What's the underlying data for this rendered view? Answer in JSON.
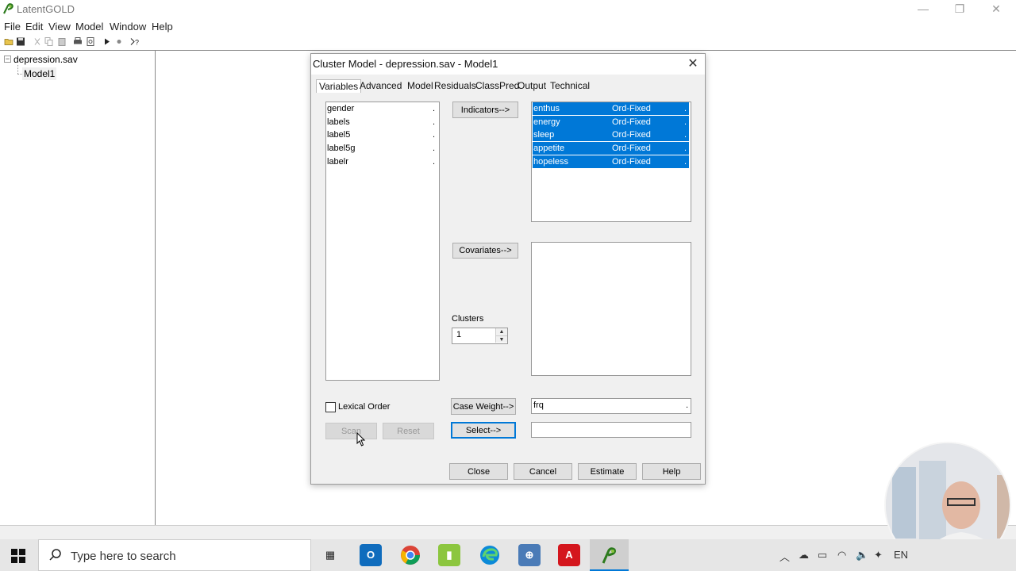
{
  "app": {
    "title": "LatentGOLD",
    "window_controls": {
      "minimize": "—",
      "maximize": "❐",
      "close": "✕"
    }
  },
  "menu": [
    "File",
    "Edit",
    "View",
    "Model",
    "Window",
    "Help"
  ],
  "toolbar_icons": [
    "open-icon",
    "save-icon",
    "cut-icon",
    "copy-icon",
    "paste-icon",
    "print-icon",
    "print-preview-icon",
    "run-icon",
    "stop-icon",
    "help-context-icon"
  ],
  "tree": {
    "root": "depression.sav",
    "child": "Model1"
  },
  "dialog": {
    "title": "Cluster Model - depression.sav - Model1",
    "tabs": [
      "Variables",
      "Advanced",
      "Model",
      "Residuals",
      "ClassPred",
      "Output",
      "Technical"
    ],
    "active_tab": "Variables",
    "available_variables": [
      "gender",
      "labels",
      "label5",
      "label5g",
      "labelr"
    ],
    "indicators_button": "Indicators-->",
    "indicators": [
      {
        "name": "enthus",
        "type": "Ord-Fixed"
      },
      {
        "name": "energy",
        "type": "Ord-Fixed"
      },
      {
        "name": "sleep",
        "type": "Ord-Fixed"
      },
      {
        "name": "appetite",
        "type": "Ord-Fixed"
      },
      {
        "name": "hopeless",
        "type": "Ord-Fixed"
      }
    ],
    "covariates_button": "Covariates-->",
    "clusters_label": "Clusters",
    "clusters_value": "1",
    "lexical_order_label": "Lexical Order",
    "scan_button": "Scan",
    "reset_button": "Reset",
    "case_weight_button": "Case Weight-->",
    "case_weight_value": "frq",
    "select_button": "Select-->",
    "select_value": "",
    "footer_buttons": {
      "close": "Close",
      "cancel": "Cancel",
      "estimate": "Estimate",
      "help": "Help"
    }
  },
  "taskbar": {
    "search_placeholder": "Type here to search",
    "tray_lang": "EN"
  },
  "colors": {
    "selection": "#0078d7",
    "dialog_bg": "#f0f0f0"
  }
}
